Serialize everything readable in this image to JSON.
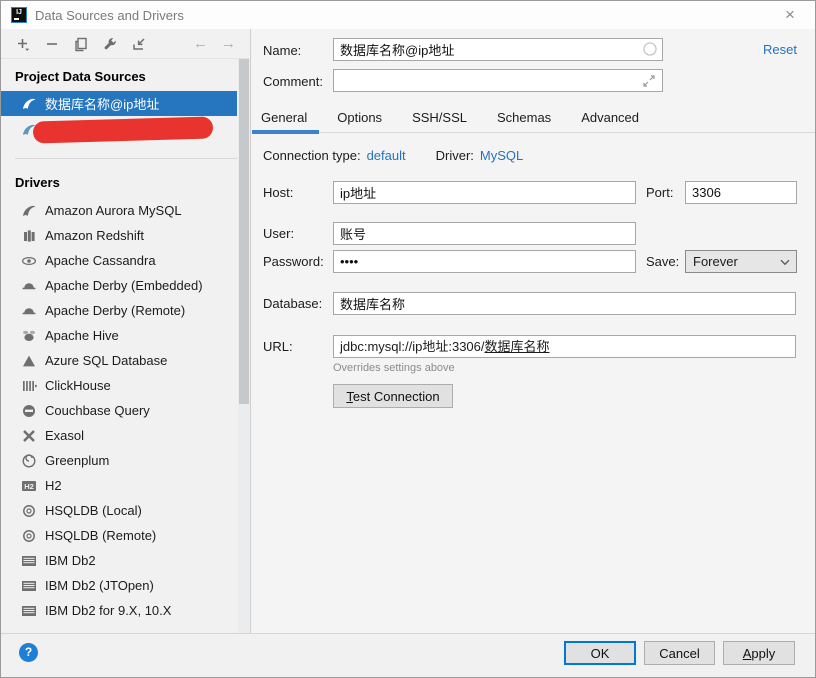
{
  "window": {
    "title": "Data Sources and Drivers"
  },
  "titlebar": {
    "close_glyph": "×"
  },
  "toolbar": {
    "back_glyph": "←",
    "forward_glyph": "→"
  },
  "sidebar": {
    "project_header": "Project Data Sources",
    "sources": [
      {
        "label": "数据库名称@ip地址",
        "selected": true,
        "icon": "mysql"
      },
      {
        "label": "",
        "redacted": true,
        "icon": "mysql"
      }
    ],
    "drivers_header": "Drivers",
    "drivers": [
      {
        "label": "Amazon Aurora MySQL",
        "icon": "mysql"
      },
      {
        "label": "Amazon Redshift",
        "icon": "redshift"
      },
      {
        "label": "Apache Cassandra",
        "icon": "cassandra"
      },
      {
        "label": "Apache Derby (Embedded)",
        "icon": "derby"
      },
      {
        "label": "Apache Derby (Remote)",
        "icon": "derby"
      },
      {
        "label": "Apache Hive",
        "icon": "hive"
      },
      {
        "label": "Azure SQL Database",
        "icon": "azure"
      },
      {
        "label": "ClickHouse",
        "icon": "clickhouse"
      },
      {
        "label": "Couchbase Query",
        "icon": "couchbase"
      },
      {
        "label": "Exasol",
        "icon": "exasol"
      },
      {
        "label": "Greenplum",
        "icon": "greenplum"
      },
      {
        "label": "H2",
        "icon": "h2"
      },
      {
        "label": "HSQLDB (Local)",
        "icon": "hsqldb"
      },
      {
        "label": "HSQLDB (Remote)",
        "icon": "hsqldb"
      },
      {
        "label": "IBM Db2",
        "icon": "ibm"
      },
      {
        "label": "IBM Db2 (JTOpen)",
        "icon": "ibm"
      },
      {
        "label": "IBM Db2 for 9.X, 10.X",
        "icon": "ibm"
      }
    ]
  },
  "form": {
    "name_label": "Name:",
    "name_value": "数据库名称@ip地址",
    "reset_label": "Reset",
    "comment_label": "Comment:",
    "comment_value": "",
    "tabs": [
      {
        "label": "General",
        "active": true
      },
      {
        "label": "Options",
        "active": false
      },
      {
        "label": "SSH/SSL",
        "active": false
      },
      {
        "label": "Schemas",
        "active": false
      },
      {
        "label": "Advanced",
        "active": false
      }
    ],
    "connection_type_label": "Connection type:",
    "connection_type_value": "default",
    "driver_label": "Driver:",
    "driver_value": "MySQL",
    "host_label": "Host:",
    "host_value": "ip地址",
    "port_label": "Port:",
    "port_value": "3306",
    "user_label": "User:",
    "user_value": "账号",
    "password_label": "Password:",
    "password_value": "••••",
    "save_label": "Save:",
    "save_value": "Forever",
    "database_label": "Database:",
    "database_value": "数据库名称",
    "url_label": "URL:",
    "url_value_prefix": "jdbc:mysql://ip地址:3306/",
    "url_value_database": "数据库名称",
    "url_hint": "Overrides settings above",
    "test_connection_label": "Test Connection"
  },
  "footer": {
    "ok_label": "OK",
    "cancel_label": "Cancel",
    "apply_label": "Apply"
  },
  "colors": {
    "selection_blue": "#2675bf",
    "link_blue": "#2572c4",
    "tab_underline_blue": "#3c82cc",
    "default_button_accent": "#0078d7",
    "redaction_red": "#e8332e"
  }
}
